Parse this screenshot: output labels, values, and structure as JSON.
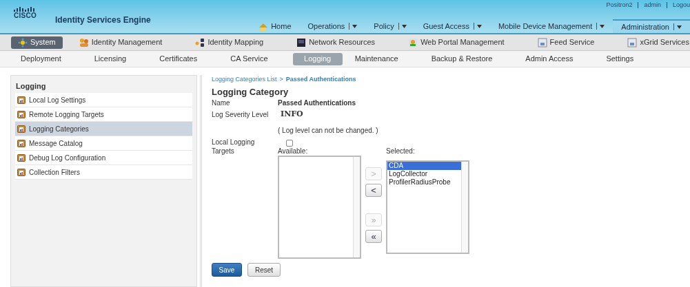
{
  "header": {
    "logo": "CISCO",
    "title": "Identity Services Engine",
    "user_links": [
      "Positron2",
      "admin",
      "Logou"
    ]
  },
  "main_nav": [
    {
      "label": "Home",
      "has_menu": false,
      "selected": false
    },
    {
      "label": "Operations",
      "has_menu": true,
      "selected": false
    },
    {
      "label": "Policy",
      "has_menu": true,
      "selected": false
    },
    {
      "label": "Guest Access",
      "has_menu": true,
      "selected": false
    },
    {
      "label": "Mobile Device Management",
      "has_menu": true,
      "selected": false
    },
    {
      "label": "Administration",
      "has_menu": true,
      "selected": true
    }
  ],
  "section_nav": [
    {
      "label": "System",
      "selected": true
    },
    {
      "label": "Identity Management",
      "selected": false
    },
    {
      "label": "Identity Mapping",
      "selected": false
    },
    {
      "label": "Network Resources",
      "selected": false
    },
    {
      "label": "Web Portal Management",
      "selected": false
    },
    {
      "label": "Feed Service",
      "selected": false
    },
    {
      "label": "xGrid Services",
      "selected": false
    }
  ],
  "tabs": [
    {
      "label": "Deployment",
      "selected": false
    },
    {
      "label": "Licensing",
      "selected": false
    },
    {
      "label": "Certificates",
      "selected": false
    },
    {
      "label": "CA Service",
      "selected": false
    },
    {
      "label": "Logging",
      "selected": true
    },
    {
      "label": "Maintenance",
      "selected": false
    },
    {
      "label": "Backup & Restore",
      "selected": false
    },
    {
      "label": "Admin Access",
      "selected": false
    },
    {
      "label": "Settings",
      "selected": false
    }
  ],
  "sidebar": {
    "title": "Logging",
    "items": [
      {
        "label": "Local Log Settings",
        "selected": false
      },
      {
        "label": "Remote Logging Targets",
        "selected": false
      },
      {
        "label": "Logging Categories",
        "selected": true
      },
      {
        "label": "Message Catalog",
        "selected": false
      },
      {
        "label": "Debug Log Configuration",
        "selected": false
      },
      {
        "label": "Collection Filters",
        "selected": false
      }
    ]
  },
  "breadcrumb": {
    "link": "Logging Categories List",
    "separator": ">",
    "current": "Passed Authentications"
  },
  "form": {
    "title": "Logging Category",
    "name_label": "Name",
    "name_value": "Passed Authentications",
    "severity_label": "Log Severity Level",
    "severity_value": "INFO",
    "severity_note": "( Log level can not be changed. )",
    "local_logging_label": "Local Logging",
    "local_logging_checked": false,
    "targets_label": "Targets",
    "available_label": "Available:",
    "selected_label": "Selected:",
    "selected_items": [
      {
        "label": "CDA",
        "selected": true
      },
      {
        "label": "LogCollector",
        "selected": false
      },
      {
        "label": "ProfilerRadiusProbe",
        "selected": false
      }
    ],
    "move_buttons": [
      {
        "label": ">",
        "disabled": true
      },
      {
        "label": "<",
        "disabled": false
      },
      {
        "label": "»",
        "disabled": true
      },
      {
        "label": "«",
        "disabled": false
      }
    ],
    "buttons": [
      {
        "label": "Save",
        "kind": "primary"
      },
      {
        "label": "Reset",
        "kind": "secondary"
      }
    ]
  }
}
